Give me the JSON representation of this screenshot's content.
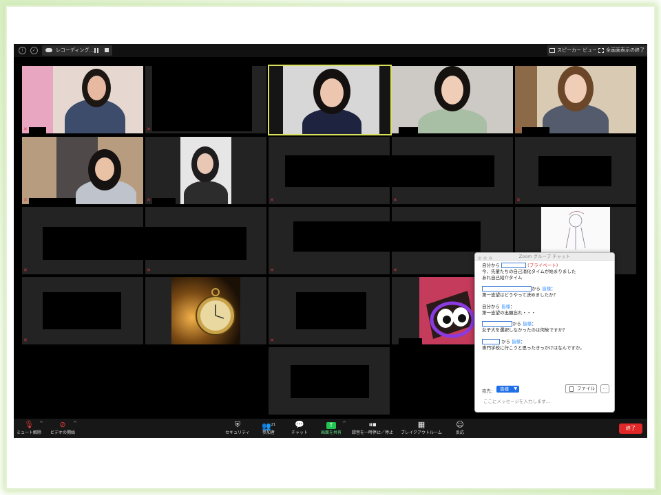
{
  "window": {
    "recording_label": "レコーディング...",
    "speaker_view_label": "スピーカー ビュー",
    "exit_fullscreen_label": "全画面表示の終了",
    "info_icon": "info-icon",
    "shield_icon": "shield-icon"
  },
  "chat": {
    "title": "Zoom グループ チャット",
    "messages": [
      {
        "prefix": "自分から",
        "private_label": "(プライベート)",
        "lines": [
          "今、先輩たちの自己消化タイムが始まりました",
          "あれ自己紹介タイム"
        ]
      },
      {
        "from_suffix": "から",
        "to": "皆様",
        "colon": "：",
        "lines": [
          "第一志望はどうやって決めましたか？"
        ]
      },
      {
        "prefix": "自分から",
        "to": "皆様",
        "colon": "：",
        "lines": [
          "第一志望の出願忘れ・・・"
        ]
      },
      {
        "from_suffix": "から",
        "to": "皆様",
        "colon": "：",
        "lines": [
          "女子大を選択しなかったのは何故ですか？"
        ]
      },
      {
        "from_suffix": "から",
        "to": "皆様",
        "colon": "：",
        "lines": [
          "専門学校に行こうと思ったきっかけはなんですか。"
        ]
      }
    ],
    "send_to_label": "宛先：",
    "send_to_value": "皆様",
    "file_button": "ファイル",
    "more_button": "...",
    "input_placeholder": "ここにメッセージを入力します..."
  },
  "toolbar": {
    "mute": "ミュート解除",
    "video": "ビデオの開始",
    "security": "セキュリティ",
    "participants": "参加者",
    "participants_count": "21",
    "chat": "チャット",
    "share": "画面を共有",
    "recording": "録音を一時停止／停止",
    "breakout": "ブレイクアウトルーム",
    "reactions": "反応",
    "end": "終了"
  },
  "colors": {
    "active_speaker_border": "#d8e25a",
    "muted_icon": "#e03a3a",
    "share_green": "#23c552",
    "end_red": "#e02828",
    "chat_blue": "#2d8cff"
  }
}
